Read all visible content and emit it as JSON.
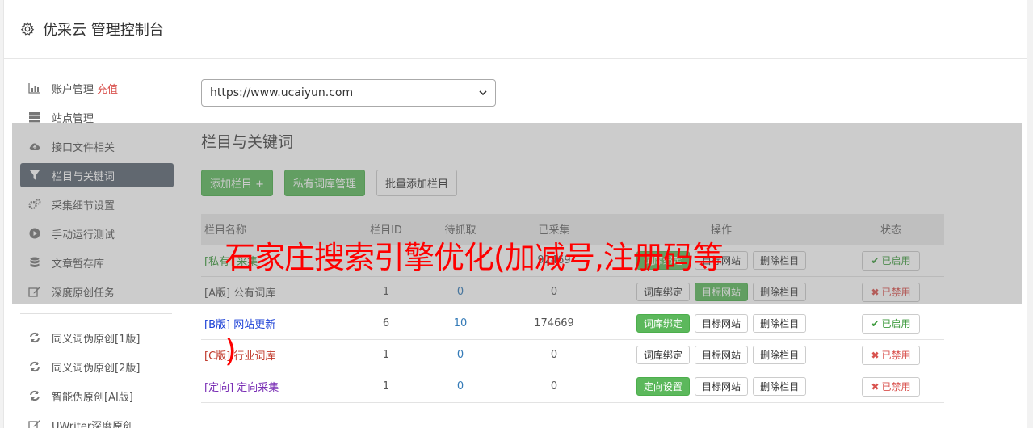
{
  "header": {
    "title": "优采云 管理控制台",
    "icon": "gear-icon"
  },
  "sidebar": {
    "items": [
      {
        "label": "账户管理",
        "extra": "充值",
        "icon": "bar-chart-icon"
      },
      {
        "label": "站点管理",
        "icon": "server-icon"
      },
      {
        "label": "接口文件相关",
        "icon": "cloud-upload-icon"
      },
      {
        "label": "栏目与关键词",
        "icon": "filter-icon",
        "active": true
      },
      {
        "label": "采集细节设置",
        "icon": "cogs-icon"
      },
      {
        "label": "手动运行测试",
        "icon": "play-circle-icon"
      },
      {
        "label": "文章暂存库",
        "icon": "database-icon"
      },
      {
        "label": "深度原创任务",
        "icon": "edit-icon"
      }
    ],
    "items2": [
      {
        "label": "同义词伪原创[1版]",
        "icon": "refresh-icon"
      },
      {
        "label": "同义词伪原创[2版]",
        "icon": "refresh-icon"
      },
      {
        "label": "智能伪原创[AI版]",
        "icon": "refresh-icon"
      },
      {
        "label": "UWriter深度原创",
        "icon": "edit-icon"
      }
    ]
  },
  "main": {
    "site_select": "https://www.ucaiyun.com",
    "section_title": "栏目与关键词",
    "buttons": {
      "add": "添加栏目 +",
      "private": "私有词库管理",
      "batch": "批量添加栏目"
    },
    "table": {
      "headers": [
        "栏目名称",
        "栏目ID",
        "待抓取",
        "已采集",
        "操作",
        "状态"
      ],
      "rows": [
        {
          "tag": "[私有]",
          "name": "采集",
          "id": "",
          "pending": "",
          "collected": "92469",
          "op1": "词库绑定",
          "op2": "目标网站",
          "op3": "删除栏目",
          "status": "已启用"
        },
        {
          "tag": "[A版]",
          "name": "公有词库",
          "id": "1",
          "pending": "0",
          "collected": "0",
          "op1": "词库绑定",
          "op2": "目标网站",
          "op3": "删除栏目",
          "status": "已禁用"
        },
        {
          "tag": "[B版]",
          "name": "网站更新",
          "id": "6",
          "pending": "10",
          "collected": "174669",
          "op1": "词库绑定",
          "op2": "目标网站",
          "op3": "删除栏目",
          "status": "已启用"
        },
        {
          "tag": "[C版]",
          "name": "行业词库",
          "id": "1",
          "pending": "0",
          "collected": "0",
          "op1": "词库绑定",
          "op2": "目标网站",
          "op3": "删除栏目",
          "status": "已禁用"
        },
        {
          "tag": "[定向]",
          "name": "定向采集",
          "id": "1",
          "pending": "0",
          "collected": "0",
          "op1": "定向设置",
          "op2": "目标网站",
          "op3": "删除栏目",
          "status": "已禁用"
        }
      ]
    }
  },
  "watermark": {
    "line1": "石家庄搜索引擎优化(加减号,注册码等",
    "line2": ")"
  },
  "colors": {
    "green": "#5cb85c",
    "red": "#d9534f",
    "nav_active": "#5b6672",
    "watermark": "#ff0000"
  }
}
